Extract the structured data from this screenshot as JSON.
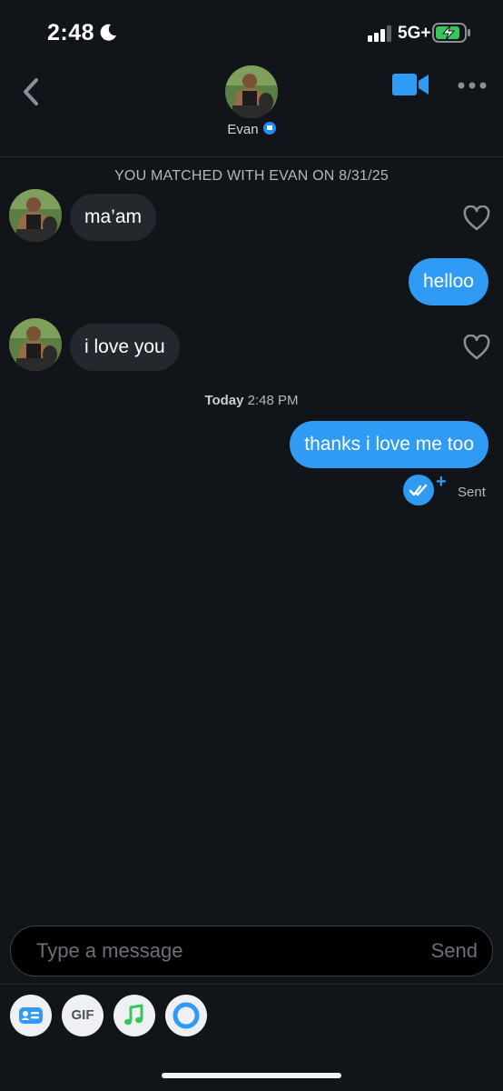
{
  "status_bar": {
    "time": "2:48",
    "network": "5G+"
  },
  "header": {
    "name": "Evan"
  },
  "chat": {
    "match_banner": "YOU MATCHED WITH EVAN ON 8/31/25",
    "messages": [
      {
        "direction": "in",
        "text": "ma’am"
      },
      {
        "direction": "out",
        "text": "helloo"
      },
      {
        "direction": "in",
        "text": "i love you"
      },
      {
        "direction": "out",
        "text": "thanks i love me too"
      }
    ],
    "timestamp_day": "Today",
    "timestamp_time": "2:48 PM",
    "plus": "+",
    "status": "Sent"
  },
  "composer": {
    "placeholder": "Type a message",
    "send_label": "Send"
  },
  "toolbar": {
    "gif_label": "GIF"
  },
  "colors": {
    "background": "#111418",
    "incoming": "#23272e",
    "outgoing": "#2f9bf4",
    "accent": "#1f8ef1"
  }
}
